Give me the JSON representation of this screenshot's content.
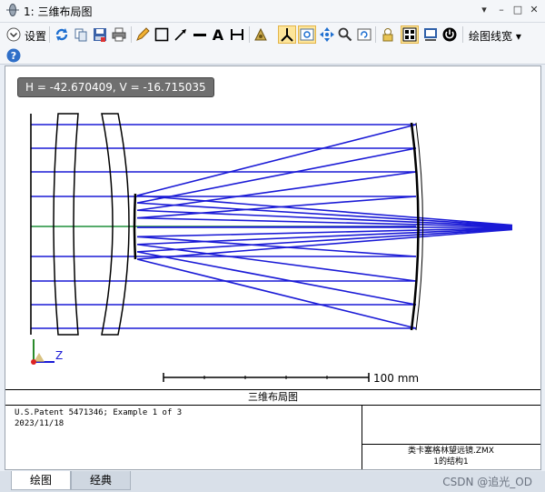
{
  "window": {
    "title": "1: 三维布局图"
  },
  "toolbar": {
    "settings_label": "设置",
    "line_width_label": "绘图线宽",
    "help_label": "?"
  },
  "plot": {
    "cursor_readout": "H = -42.670409, V = -16.715035",
    "scale_label": "100 mm",
    "axis_z_label": "Z",
    "caption": "三维布局图"
  },
  "info": {
    "line1": "U.S.Patent 5471346; Example 1 of 3",
    "line2": "2023/11/18",
    "file_name": "类卡塞格林望远镜.ZMX",
    "config": "1的结构1"
  },
  "tabs": [
    {
      "label": "绘图",
      "selected": true
    },
    {
      "label": "经典",
      "selected": false
    }
  ],
  "watermark": "CSDN @追光_OD",
  "colors": {
    "ray": "#1a1ad6",
    "ray_alt": "#1f8f3a",
    "lens": "#000000",
    "active_tool": "#fde59a"
  }
}
